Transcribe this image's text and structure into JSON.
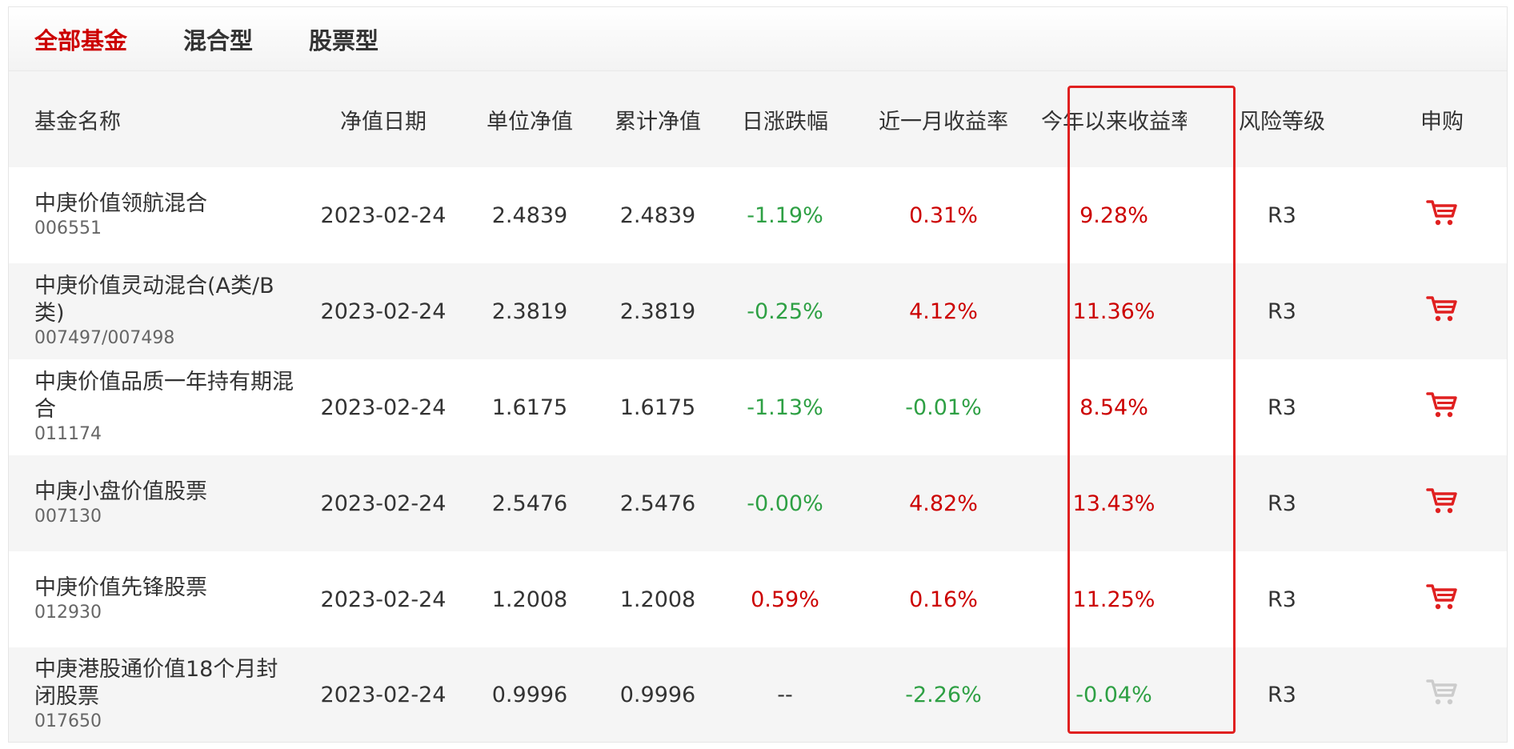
{
  "tabs": [
    {
      "label": "全部基金",
      "active": true
    },
    {
      "label": "混合型",
      "active": false
    },
    {
      "label": "股票型",
      "active": false
    }
  ],
  "columns": {
    "name": "基金名称",
    "date": "净值日期",
    "nav": "单位净值",
    "acc_nav": "累计净值",
    "daily": "日涨跌幅",
    "month": "近一月收益率",
    "ytd": "今年以来收益率",
    "risk": "风险等级",
    "buy": "申购"
  },
  "rows": [
    {
      "name": "中庚价值领航混合",
      "code": "006551",
      "date": "2023-02-24",
      "nav": "2.4839",
      "acc_nav": "2.4839",
      "daily": "-1.19%",
      "month": "0.31%",
      "ytd": "9.28%",
      "risk": "R3"
    },
    {
      "name": "中庚价值灵动混合(A类/B类)",
      "code": "007497/007498",
      "date": "2023-02-24",
      "nav": "2.3819",
      "acc_nav": "2.3819",
      "daily": "-0.25%",
      "month": "4.12%",
      "ytd": "11.36%",
      "risk": "R3"
    },
    {
      "name": "中庚价值品质一年持有期混合",
      "code": "011174",
      "date": "2023-02-24",
      "nav": "1.6175",
      "acc_nav": "1.6175",
      "daily": "-1.13%",
      "month": "-0.01%",
      "ytd": "8.54%",
      "risk": "R3"
    },
    {
      "name": "中庚小盘价值股票",
      "code": "007130",
      "date": "2023-02-24",
      "nav": "2.5476",
      "acc_nav": "2.5476",
      "daily": "-0.00%",
      "month": "4.82%",
      "ytd": "13.43%",
      "risk": "R3"
    },
    {
      "name": "中庚价值先锋股票",
      "code": "012930",
      "date": "2023-02-24",
      "nav": "1.2008",
      "acc_nav": "1.2008",
      "daily": "0.59%",
      "month": "0.16%",
      "ytd": "11.25%",
      "risk": "R3"
    },
    {
      "name": "中庚港股通价值18个月封闭股票",
      "code": "017650",
      "date": "2023-02-24",
      "nav": "0.9996",
      "acc_nav": "0.9996",
      "daily": "--",
      "month": "-2.26%",
      "ytd": "-0.04%",
      "risk": "R3"
    }
  ],
  "icons": {
    "cart": "shopping-cart-icon"
  },
  "colors": {
    "active_tab": "#cc0000",
    "positive": "#cc0000",
    "negative": "#2ea044",
    "highlight_border": "#e02020",
    "cart_enabled": "#e02020",
    "cart_disabled": "#cccccc"
  },
  "cart_enabled": [
    true,
    true,
    true,
    true,
    true,
    false
  ]
}
